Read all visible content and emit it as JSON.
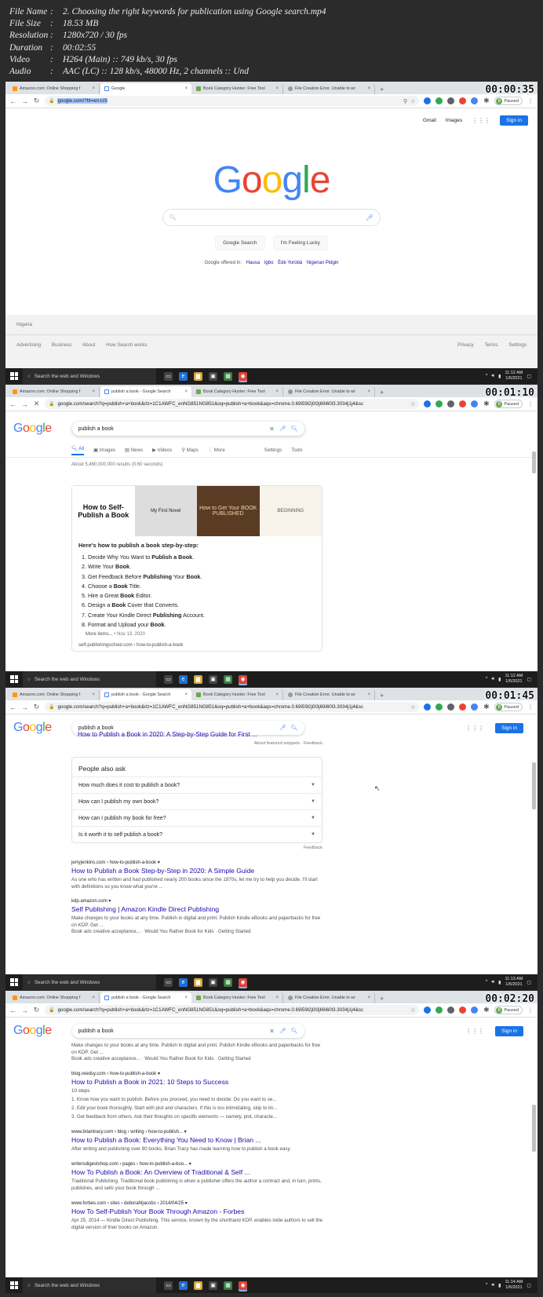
{
  "meta": [
    {
      "k": "File Name",
      "v": "2. Choosing the right keywords for publication using Google search.mp4"
    },
    {
      "k": "File Size",
      "v": "18.53 MB"
    },
    {
      "k": "Resolution",
      "v": "1280x720 / 30 fps"
    },
    {
      "k": "Duration",
      "v": "00:02:55"
    },
    {
      "k": "Video",
      "v": "H264 (Main) :: 749 kb/s, 30 fps"
    },
    {
      "k": "Audio",
      "v": "AAC (LC) :: 128 kb/s, 48000 Hz, 2 channels :: Und"
    }
  ],
  "colon": ":",
  "tabs": {
    "amazon": "Amazon.com: Online Shopping f",
    "google_home": "Google",
    "google_results": "publish a book - Google Search",
    "bch": "Book Category Hunter: Free Tool",
    "fce": "File Creation Error. Unable to wr",
    "x": "×",
    "new": "+"
  },
  "toolbar": {
    "url_home": "google.com/?hl=en-US",
    "url_results": "google.com/search?q=publish+a+book&rlz=1C1AWFC_enNG851NG851&oq=publish+a+book&aqs=chrome.0.69i59l2j0l3j69i60l3.3034j1j4&sc",
    "paused": "Paused",
    "profile_letter": "B"
  },
  "taskbar": {
    "search_placeholder": "Search the web and Windows",
    "frames": [
      {
        "time": "11:12 AM",
        "date": "1/6/2021"
      },
      {
        "time": "11:12 AM",
        "date": "1/6/2021"
      },
      {
        "time": "11:13 AM",
        "date": "1/6/2021"
      },
      {
        "time": "11:14 AM",
        "date": "1/6/2021"
      }
    ]
  },
  "timestamps": [
    "00:00:35",
    "00:01:10",
    "00:01:45",
    "00:02:20"
  ],
  "home": {
    "gmail": "Gmail",
    "images": "Images",
    "signin": "Sign in",
    "btn_search": "Google Search",
    "btn_lucky": "I'm Feeling Lucky",
    "offered_label": "Google offered in:",
    "languages": [
      "Hausa",
      "Igbo",
      "Èdè Yorùbá",
      "Nigerian Pidgin"
    ],
    "country": "Nigeria",
    "footer_left": [
      "Advertising",
      "Business",
      "About",
      "How Search works"
    ],
    "footer_right": [
      "Privacy",
      "Terms",
      "Settings"
    ]
  },
  "logo": {
    "l1": "G",
    "l2": "o",
    "l3": "o",
    "l4": "g",
    "l5": "l",
    "l6": "e"
  },
  "results": {
    "query": "publish a book",
    "tabs": [
      "All",
      "Images",
      "News",
      "Videos",
      "Maps",
      "More"
    ],
    "settings": "Settings",
    "tools": "Tools",
    "stats": "About 5,460,000,000 results (0.60 seconds)",
    "thumb1": "How to Self-Publish a Book",
    "thumb2": "My First Novel",
    "thumb3": "How to Get Your BOOK PUBLISHED",
    "thumb4": "BEGINNING",
    "snippet_title": "Here's how to publish a book step-by-step:",
    "steps": [
      [
        "Decide Why You Want to ",
        "Publish a Book",
        "."
      ],
      [
        "Write Your ",
        "Book",
        "."
      ],
      [
        "Get Feedback Before ",
        "Publishing",
        " Your ",
        "Book",
        "."
      ],
      [
        "Choose a ",
        "Book",
        " Title."
      ],
      [
        "Hire a Great ",
        "Book",
        " Editor."
      ],
      [
        "Design a ",
        "Book",
        " Cover that Converts."
      ],
      [
        "Create Your Kindle Direct ",
        "Publishing",
        " Account."
      ],
      [
        "Format and Upload your ",
        "Book",
        "."
      ]
    ],
    "more_items": "More items...",
    "more_date": "• Nov 13, 2020",
    "snippet_cite": "self-publishingschool.com › how-to-publish-a-book",
    "featured_partial": "How to Publish a Book in 2020: A Step-by-Step Guide for First ...",
    "about_fs": "About featured snippets",
    "feedback": "Feedback",
    "paa_title": "People also ask",
    "paa": [
      "How much does it cost to publish a book?",
      "How can I publish my own book?",
      "How can I publish my book for free?",
      "Is it worth it to self publish a book?"
    ],
    "r1_cite": "jerryjenkins.com › how-to-publish-a-book",
    "r1_title": "How to Publish a Book Step-by-Step in 2020: A Simple Guide",
    "r1_desc": "As one who has written and had published nearly 200 books since the 1970s, let me try to help you decide. I'll start with definitions so you know what you're ...",
    "r2_cite": "kdp.amazon.com",
    "r2_title": "Self Publishing | Amazon Kindle Direct Publishing",
    "r2_desc": "Make changes to your books at any time. Publish in digital and print. Publish Kindle eBooks and paperbacks for free on KDP. Get ...",
    "r2_sub": "Book ads creative acceptance... · Would You Rather Book for Kids · Getting Started",
    "r3_cite": "blog.reedsy.com › how-to-publish-a-book",
    "r3_title": "How to Publish a Book in 2021: 10 Steps to Success",
    "r3_steps_label": "10 steps",
    "r3_list": [
      "1.  Know how you want to publish. Before you proceed, you need to decide: Do you want to se...",
      "2.  Edit your book thoroughly. Start with plot and characters. If this is too intimidating, skip to lin...",
      "3.  Get feedback from others. Ask their thoughts on specific elements — namely, plot, characte..."
    ],
    "r4_cite": "www.briantracy.com › blog › writing › how-to-publish...",
    "r4_title": "How to Publish a Book: Everything You Need to Know | Brian ...",
    "r4_desc": "After writing and publishing over 80 books, Brian Tracy has made learning how to publish a book easy.",
    "r5_cite": "writersdigestshop.com › pages › how-to-publish-a-boo...",
    "r5_title": "How To Publish a Book: An Overview of Traditional & Self ...",
    "r5_desc": "Traditional Publishing. Traditional book publishing is when a publisher offers the author a contract and, in turn, prints, publishes, and sells your book through ...",
    "r6_cite": "www.forbes.com › sites › deborahljacobs › 2014/04/25",
    "r6_title": "How To Self-Publish Your Book Through Amazon - Forbes",
    "r6_desc": "Apr 25, 2014 — Kindle Direct Publishing. This service, known by the shorthand KDP, enables indie authors to sell the digital version of their books on Amazon."
  },
  "colors": {
    "accent": "#1a73e8",
    "link": "#1a0dab",
    "taskbar": "#1d1d1d"
  }
}
